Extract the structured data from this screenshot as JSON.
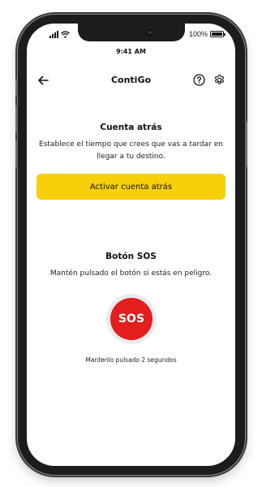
{
  "status_bar": {
    "time": "9:41 AM",
    "battery_label": "100%",
    "icons": [
      "signal-icon",
      "wifi-icon",
      "battery-icon"
    ]
  },
  "header": {
    "title": "ContiGo",
    "icons": [
      "back-arrow-icon",
      "help-icon",
      "gear-icon"
    ]
  },
  "countdown": {
    "title": "Cuenta atrás",
    "description": "Establece el tiempo que crees que vas a tardar en llegar a tu destino.",
    "button_label": "Activar cuenta atrás"
  },
  "sos": {
    "title": "Botón SOS",
    "description": "Mantén pulsado el botón si estás en peligro.",
    "button_label": "SOS",
    "hint": "Mantenlo pulsado 2 segundos"
  },
  "colors": {
    "accent_yellow": "#f7cf0a",
    "sos_red": "#e21e1e",
    "phone_frame": "#1c1c1c"
  }
}
